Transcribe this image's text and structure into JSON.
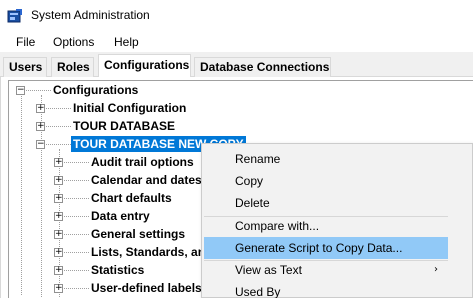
{
  "window": {
    "title": "System Administration",
    "icon": "app-window-icon"
  },
  "menubar": {
    "items": [
      "File",
      "Options",
      "Help"
    ]
  },
  "tabs": [
    {
      "label": "Users",
      "active": false
    },
    {
      "label": "Roles",
      "active": false
    },
    {
      "label": "Configurations",
      "active": true
    },
    {
      "label": "Database Connections",
      "active": false
    }
  ],
  "tree": {
    "root": "Configurations",
    "level1": [
      "Initial Configuration",
      "TOUR DATABASE",
      "TOUR DATABASE NEW COPY"
    ],
    "selected": "TOUR DATABASE NEW COPY",
    "children": [
      "Audit trail options",
      "Calendar and dates",
      "Chart defaults",
      "Data entry",
      "General settings",
      "Lists, Standards, an",
      "Statistics",
      "User-defined labels"
    ]
  },
  "context_menu": {
    "items": [
      {
        "label": "Rename",
        "highlighted": false,
        "submenu": false
      },
      {
        "label": "Copy",
        "highlighted": false,
        "submenu": false
      },
      {
        "label": "Delete",
        "highlighted": false,
        "submenu": false
      },
      {
        "label": "Compare with...",
        "highlighted": false,
        "submenu": false
      },
      {
        "label": "Generate Script to Copy Data...",
        "highlighted": true,
        "submenu": false
      },
      {
        "label": "View as Text",
        "highlighted": false,
        "submenu": true
      },
      {
        "label": "Used By",
        "highlighted": false,
        "submenu": false
      }
    ]
  },
  "colors": {
    "selection": "#0078d7",
    "menu_hover": "#91c9f7"
  }
}
